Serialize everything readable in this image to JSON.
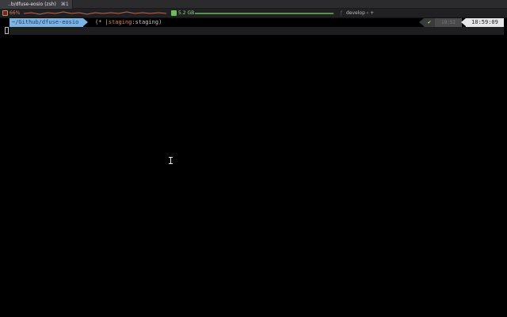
{
  "window": {
    "tab_title": "..b/dfuse-eosio (zsh)",
    "tab_shortcut": "⌘1"
  },
  "statusbar": {
    "cpu_icon": "cpu-icon",
    "cpu_value": "66%",
    "cpu_color": "#e07a5f",
    "memory_icon": "memory-icon",
    "memory_value": "5.2 GB",
    "memory_color": "#6bbf59",
    "branch_icon": "git-branch-icon",
    "branch_glyph": "ᚴ",
    "branch_value": "develop ‹ +"
  },
  "prompt": {
    "path": "~/Github/dfuse-eosio",
    "git_open": "(",
    "git_star": "*",
    "git_bar": "|",
    "git_branch": "staging",
    "git_remote": ":staging)",
    "status_check": "✔",
    "status_dim": "19:52",
    "time": "10:59:09",
    "path_color": "#7ab3e8",
    "branch_color": "#e0864e"
  }
}
